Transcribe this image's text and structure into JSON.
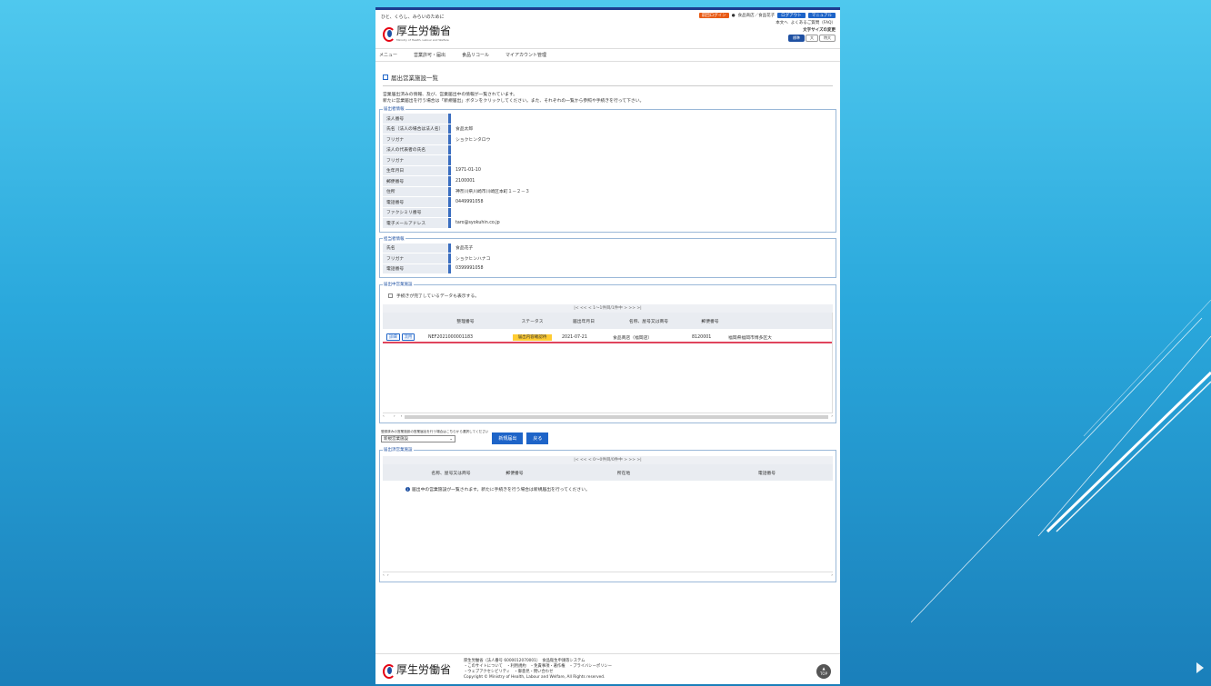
{
  "header": {
    "slogan": "ひと、くらし、みらいのために",
    "logo_text": "厚生労働省",
    "logo_sub": "Ministry of Health, Labour and Welfare",
    "prev_login": "前回ログイン",
    "user": "食品商店／食品花子",
    "logout": "ログアウト",
    "manual": "マニュアル",
    "to_main": "本文へ",
    "faq": "よくあるご質問（FAQ）",
    "font_size": "文字サイズの変更",
    "fs_standard": "標準",
    "fs_large": "大",
    "fs_extra": "特大"
  },
  "nav": [
    "メニュー",
    "営業許可・届出",
    "食品リコール",
    "マイアカウント管理"
  ],
  "page_title": "届出営業施設一覧",
  "intro": [
    "営業届出済みの情報、及び、営業届出中の情報が一覧されています。",
    "新たに営業届出を行う場合は「新規届出」ボタンをクリックしてください。また、それぞれの一覧から参照や手続きを行って下さい。"
  ],
  "applicant": {
    "legend": "届出者情報",
    "rows": [
      {
        "label": "法人番号",
        "value": ""
      },
      {
        "label": "氏名（法人の場合は法人名）",
        "value": "食品太郎"
      },
      {
        "label": "フリガナ",
        "value": "ショクヒンタロウ"
      },
      {
        "label": "法人の代表者の氏名",
        "value": ""
      },
      {
        "label": "フリガナ",
        "value": ""
      },
      {
        "label": "生年月日",
        "value": "1971-01-10"
      },
      {
        "label": "郵便番号",
        "value": "2100001"
      },
      {
        "label": "住所",
        "value": "神奈川県川崎市川崎区本町１－２－３"
      },
      {
        "label": "電話番号",
        "value": "0449991058"
      },
      {
        "label": "ファクシミリ番号",
        "value": ""
      },
      {
        "label": "電子メールアドレス",
        "value": "taro@syokuhin.co.jp"
      }
    ]
  },
  "contact": {
    "legend": "担当者情報",
    "rows": [
      {
        "label": "氏名",
        "value": "食品花子"
      },
      {
        "label": "フリガナ",
        "value": "ショクヒンハナコ"
      },
      {
        "label": "電話番号",
        "value": "0399991058"
      }
    ]
  },
  "in_progress": {
    "legend": "届出中営業施設",
    "show_completed": "手続きが完了しているデータも表示する。",
    "pager": "|<  <<  <  1〜1件目/1件中  >  >>  >|",
    "headers": [
      "",
      "整理番号",
      "ステータス",
      "届出年月日",
      "名称、屋号又は商号",
      "郵便番号",
      ""
    ],
    "row": {
      "btn_detail": "詳細",
      "btn_copy": "流用",
      "number": "NEF2021000001183",
      "status": "届出内容確認待",
      "date": "2021-07-21",
      "name": "食品商店（福岡店）",
      "zip": "8120001",
      "address": "福岡県福岡市博多区大"
    }
  },
  "actions": {
    "select_hint": "登録済みの営業施設の営業届出を行う場合はこちらから選択してください",
    "select_value": "新規営業施設",
    "btn_new": "新規届出",
    "btn_back": "戻る"
  },
  "completed": {
    "legend": "届出済営業施設",
    "pager": "|<  <<  <  0〜0件目/0件中  >  >>  >|",
    "headers": [
      "名称、屋号又は商号",
      "郵便番号",
      "所在地",
      "電話番号"
    ],
    "empty_msg": "届出中の営業施設が一覧されます。新たに手続きを行う場合は新規届出を行ってください。"
  },
  "footer": {
    "logo_text": "厚生労働省",
    "line1": "厚生労働省（法人番号 6000012070001）　食品衛生申請等システム",
    "line2": "・このサイトについて　・利用規約　・免責事項・著作権　・プライバシーポリシー",
    "line3": "・ウェブアクセシビリティ　・御意見・問い合わせ",
    "copyright": "Copyright © Ministry of Health, Labour and Welfare, All Rights reserved.",
    "top": "TOP"
  }
}
